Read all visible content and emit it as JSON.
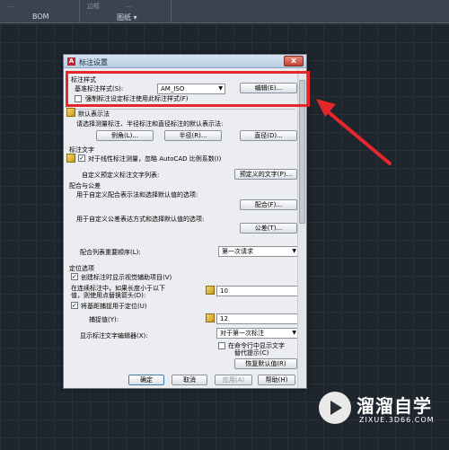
{
  "topbar": {
    "bom_label": "BOM",
    "drawing_label": "图纸 ▾",
    "ghost1": "…",
    "ghost2": "边框",
    "ghost3": "…"
  },
  "dialog": {
    "title": "标注设置",
    "close_glyph": "x",
    "section_style": "标注样式",
    "base_style_label": "基准标注样式(S):",
    "base_style_value": "AM_ISO",
    "edit_button": "编辑(E)...",
    "force_checkbox_label": "强制标注设定标注使用此标注样式(F)",
    "section_default_methods": "默认表示法",
    "default_methods_desc": "请选择测量标注、半径标注和直径标注的默认表示法:",
    "linear_button": "例角(L)...",
    "radius_button": "半径(R)...",
    "diameter_button": "直径(D)...",
    "section_dim_text": "标注文字",
    "dim_text_check_label": "对于线性标注测量，忽略 AutoCAD 比例系数(I)",
    "custom_text_label": "自定义预定义标注文字列表:",
    "predefined_text_button": "预定义的文字(P)...",
    "section_fit_tol": "配合与公差",
    "fit_desc": "用于自定义配合表示法和选择默认值的选项:",
    "fit_button": "配合(F)...",
    "tol_desc": "用于自定义公差表达方式和选择默认值的选项:",
    "tol_button": "公差(T)...",
    "fit_list_label": "配合列表重要顺序(L):",
    "fit_list_value": "第一次请求",
    "section_position": "定位选项",
    "pos_check1_label": "创建标注时显示视觉辅助项目(V)",
    "pos_line1": "在连续标注中，如果长度小于以下",
    "pos_line2": "值，则使用点替换箭头(D):",
    "pos_value1": "10",
    "pos_check2_label": "将基距捕捉用于定位(U)",
    "snap_label": "捕捉值(Y):",
    "snap_value": "12",
    "show_editor_label": "显示标注文字编辑器(X):",
    "show_editor_value": "对于第一次标注",
    "show_all_line1": "在命令行中显示文字",
    "show_all_line2": "替代提示(C)",
    "reset_button": "恢复默认值(R)",
    "ok_button": "确定",
    "cancel_button": "取消",
    "apply_button": "应用(A)",
    "help_button": "帮助(H)"
  },
  "watermark": {
    "title": "溜溜自学",
    "subtitle": "ZIXUE.3D66.COM"
  },
  "colors": {
    "annotation": "#e5262b"
  }
}
